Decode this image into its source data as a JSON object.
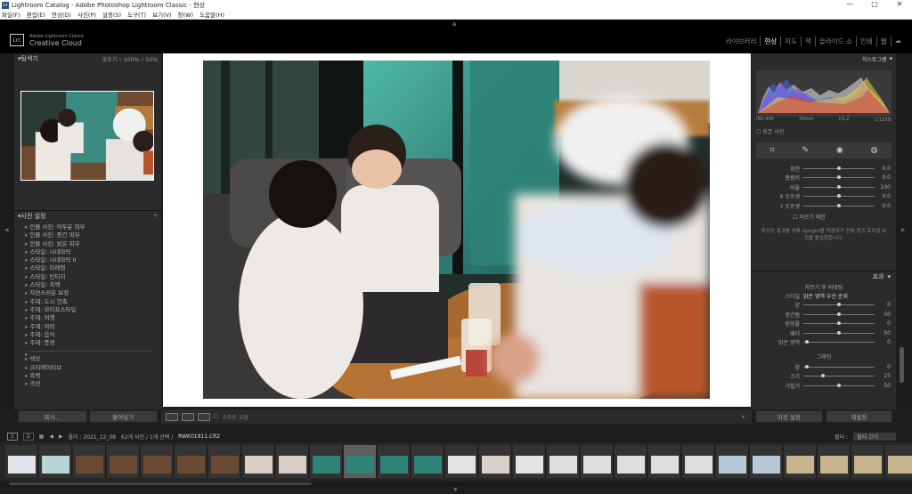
{
  "window": {
    "title": "Lightroom Catalog - Adobe Photoshop Lightroom Classic - 현상",
    "min": "—",
    "max": "▢",
    "close": "✕"
  },
  "menu": [
    "파일(F)",
    "편집(E)",
    "현상(D)",
    "사진(P)",
    "설정(S)",
    "도구(T)",
    "보기(V)",
    "창(W)",
    "도움말(H)"
  ],
  "identity": {
    "logo": "Lrc",
    "line1": "Adobe Lightroom Classic",
    "line2": "Creative Cloud"
  },
  "modules": [
    "라이브러리",
    "현상",
    "지도",
    "책",
    "슬라이드 쇼",
    "인쇄",
    "웹"
  ],
  "active_module": "현상",
  "navigator": {
    "title": "탐색기",
    "zoom": [
      "맞추기",
      "100%",
      "50%"
    ]
  },
  "presets": {
    "title": "사전 설정",
    "items": [
      "인물 사진: 어두운 피부",
      "인물 사진: 중간 피부",
      "인물 사진: 밝은 피부",
      "스타일: 시네마틱",
      "스타일: 시네마틱 II",
      "스타일: 미래형",
      "스타일: 빈티지",
      "스타일: 흑백",
      "자연스러운 보정",
      "주제: 도시 건축",
      "주제: 라이프스타일",
      "주제: 여행",
      "주제: 야외",
      "주제: 음식",
      "주제: 풍경"
    ],
    "items2": [
      "색상",
      "크리에이티브",
      "흑백",
      "곡선"
    ]
  },
  "left_buttons": [
    "복사...",
    "붙여넣기"
  ],
  "right_buttons": [
    "이전 설정",
    "재설정"
  ],
  "histogram": {
    "title": "히스토그램",
    "iso": "ISO 400",
    "focal": "50mm",
    "aperture": "f/1.2",
    "shutter": "1/125초",
    "original": "원본 사진"
  },
  "basic_sliders": [
    {
      "label": "회전",
      "value": "0.0"
    },
    {
      "label": "종횡비",
      "value": "0.0"
    },
    {
      "label": "비율",
      "value": "100"
    },
    {
      "label": "X 오프셋",
      "value": "0.0"
    },
    {
      "label": "Y 오프셋",
      "value": "0.0"
    }
  ],
  "crop_limit": "자르기 제한",
  "note": "최상의 결과를 위해 Upright를 적용하기 전에 렌즈 프로필 보정을 활성화합니다.",
  "effects": {
    "title": "효과",
    "vignette_title": "자르기 후 비네팅",
    "style_label": "스타일",
    "style_value": "밝은 영역 우선 순위",
    "sliders": [
      {
        "label": "양",
        "value": "0"
      },
      {
        "label": "중간점",
        "value": "50"
      },
      {
        "label": "원형률",
        "value": "0"
      },
      {
        "label": "페더",
        "value": "50"
      },
      {
        "label": "밝은 영역",
        "value": "0"
      }
    ],
    "grain_title": "그레인",
    "grain": [
      {
        "label": "양",
        "value": "0"
      },
      {
        "label": "크기",
        "value": "25"
      },
      {
        "label": "거칠기",
        "value": "50"
      }
    ]
  },
  "toolbar": {
    "softproof": "소프트 교정"
  },
  "filmbar": {
    "page1": "1",
    "page2": "2",
    "path": "폴더 : 2021_12_08",
    "count": "62개 사진 / 1개 선택 /",
    "file": "RWK01911.CR2",
    "filter_label": "필터 :",
    "filter_value": "필터 끄기"
  },
  "film_selected": 11,
  "film_count": 27
}
